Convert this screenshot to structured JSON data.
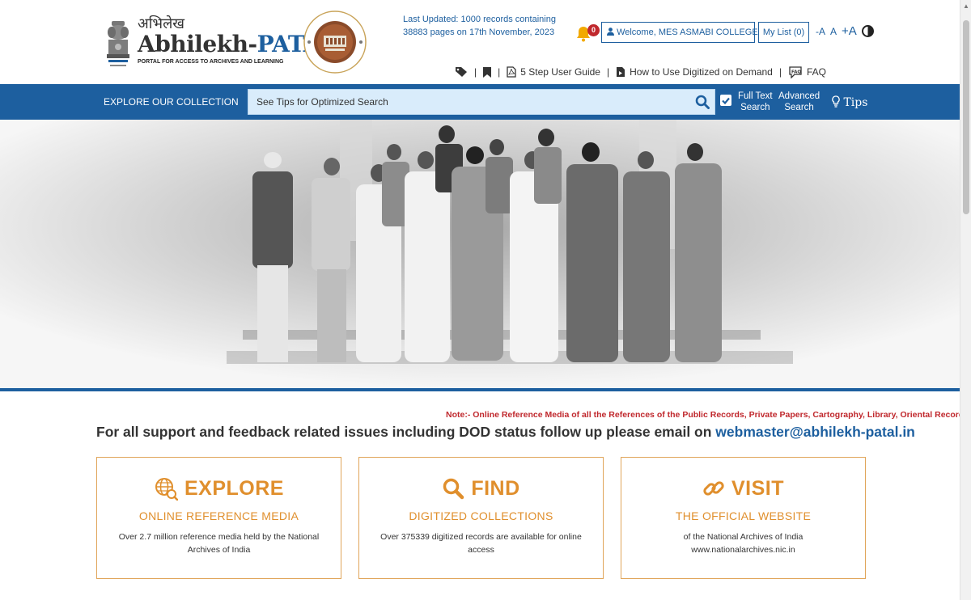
{
  "header": {
    "hindi_title": "अभिलेख",
    "title_main": "Abhilekh-",
    "title_accent": "PATAL",
    "tagline": "PORTAL FOR ACCESS TO ARCHIVES AND LEARNING",
    "last_updated": "Last Updated: 1000 records containing 38883 pages on 17th November, 2023",
    "notification_count": "0",
    "welcome": "Welcome, MES ASMABI COLLEGE",
    "my_list": "My List (0)",
    "font_small": "-A",
    "font_normal": "A",
    "font_large": "+A"
  },
  "toolbar": {
    "guide": "5 Step User Guide",
    "digitized": "How to Use Digitized on Demand",
    "faq": "FAQ"
  },
  "nav": {
    "explore": "EXPLORE OUR COLLECTION",
    "search_placeholder": "See Tips for Optimized Search",
    "fulltext_line1": "Full Text",
    "fulltext_line2": "Search",
    "advanced_line1": "Advanced",
    "advanced_line2": "Search",
    "tips": "Tips"
  },
  "note": "Note:- Online Reference Media of all the References of the Public Records, Private Papers, Cartography, Library, Oriental Records",
  "support": {
    "text": "For all support and feedback related issues including DOD status follow up please email on ",
    "email": "webmaster@abhilekh-patal.in"
  },
  "cards": [
    {
      "title": "EXPLORE",
      "subtitle": "ONLINE REFERENCE MEDIA",
      "desc": "Over 2.7 million reference media held by the National Archives of India"
    },
    {
      "title": "FIND",
      "subtitle": "DIGITIZED COLLECTIONS",
      "desc": "Over 375339 digitized records are available for online access"
    },
    {
      "title": "VISIT",
      "subtitle": "THE OFFICIAL WEBSITE",
      "desc": "of the National Archives of India www.nationalarchives.nic.in"
    }
  ],
  "colors": {
    "primary_blue": "#1d5f9f",
    "accent_orange": "#e08f2d",
    "note_red": "#c0282d",
    "search_bg": "#d9ecfb"
  },
  "icons": [
    "emblem-icon",
    "seal-icon",
    "bell-icon",
    "user-icon",
    "contrast-icon",
    "tag-icon",
    "bookmark-icon",
    "pdf-icon",
    "video-icon",
    "faq-icon",
    "search-icon",
    "checkbox-icon",
    "bulb-icon",
    "globe-icon",
    "link-icon"
  ]
}
